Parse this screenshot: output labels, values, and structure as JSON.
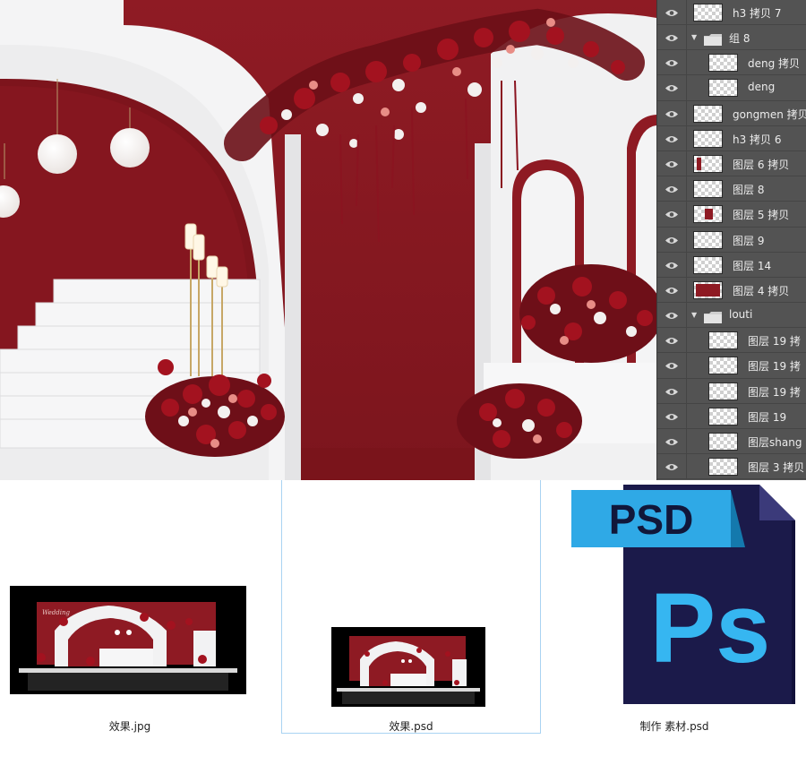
{
  "layers_panel": {
    "rows": [
      {
        "name": "h3 拷贝 7",
        "indent": 0,
        "type": "layer"
      },
      {
        "name": "组 8",
        "indent": 0,
        "type": "group"
      },
      {
        "name": "deng 拷贝",
        "indent": 1,
        "type": "layer"
      },
      {
        "name": "deng",
        "indent": 1,
        "type": "layer"
      },
      {
        "name": "gongmen  拷贝",
        "indent": 0,
        "type": "layer"
      },
      {
        "name": "h3 拷贝 6",
        "indent": 0,
        "type": "layer"
      },
      {
        "name": "图层 6 拷贝",
        "indent": 0,
        "type": "layer",
        "thumb_mark": "left"
      },
      {
        "name": "图层 8",
        "indent": 0,
        "type": "layer"
      },
      {
        "name": "图层 5 拷贝",
        "indent": 0,
        "type": "layer",
        "thumb_mark": "center"
      },
      {
        "name": "图层 9",
        "indent": 0,
        "type": "layer"
      },
      {
        "name": "图层 14",
        "indent": 0,
        "type": "layer"
      },
      {
        "name": "图层 4 拷贝",
        "indent": 0,
        "type": "layer",
        "thumb_mark": "full"
      },
      {
        "name": "louti",
        "indent": 0,
        "type": "group"
      },
      {
        "name": "图层 19 拷",
        "indent": 1,
        "type": "layer"
      },
      {
        "name": "图层 19 拷",
        "indent": 1,
        "type": "layer"
      },
      {
        "name": "图层 19 拷",
        "indent": 1,
        "type": "layer"
      },
      {
        "name": "图层 19",
        "indent": 1,
        "type": "layer"
      },
      {
        "name": "图层shang",
        "indent": 1,
        "type": "layer"
      },
      {
        "name": "图层 3 拷贝",
        "indent": 1,
        "type": "layer"
      }
    ]
  },
  "files": [
    {
      "name": "效果.jpg",
      "selected": false
    },
    {
      "name": "效果.psd",
      "selected": true
    },
    {
      "name": "制作 素材.psd",
      "selected": false
    }
  ],
  "psd_icon": {
    "badge_text": "PSD",
    "app_text": "Ps"
  },
  "thumb_text": "Wedding",
  "colors": {
    "accent_red": "#8e1a23",
    "panel_bg": "#535353",
    "ps_badge": "#2fa9e6",
    "ps_body": "#1b1a4a",
    "ps_letters": "#36b6f1",
    "selection_border": "#a9d3f2"
  }
}
